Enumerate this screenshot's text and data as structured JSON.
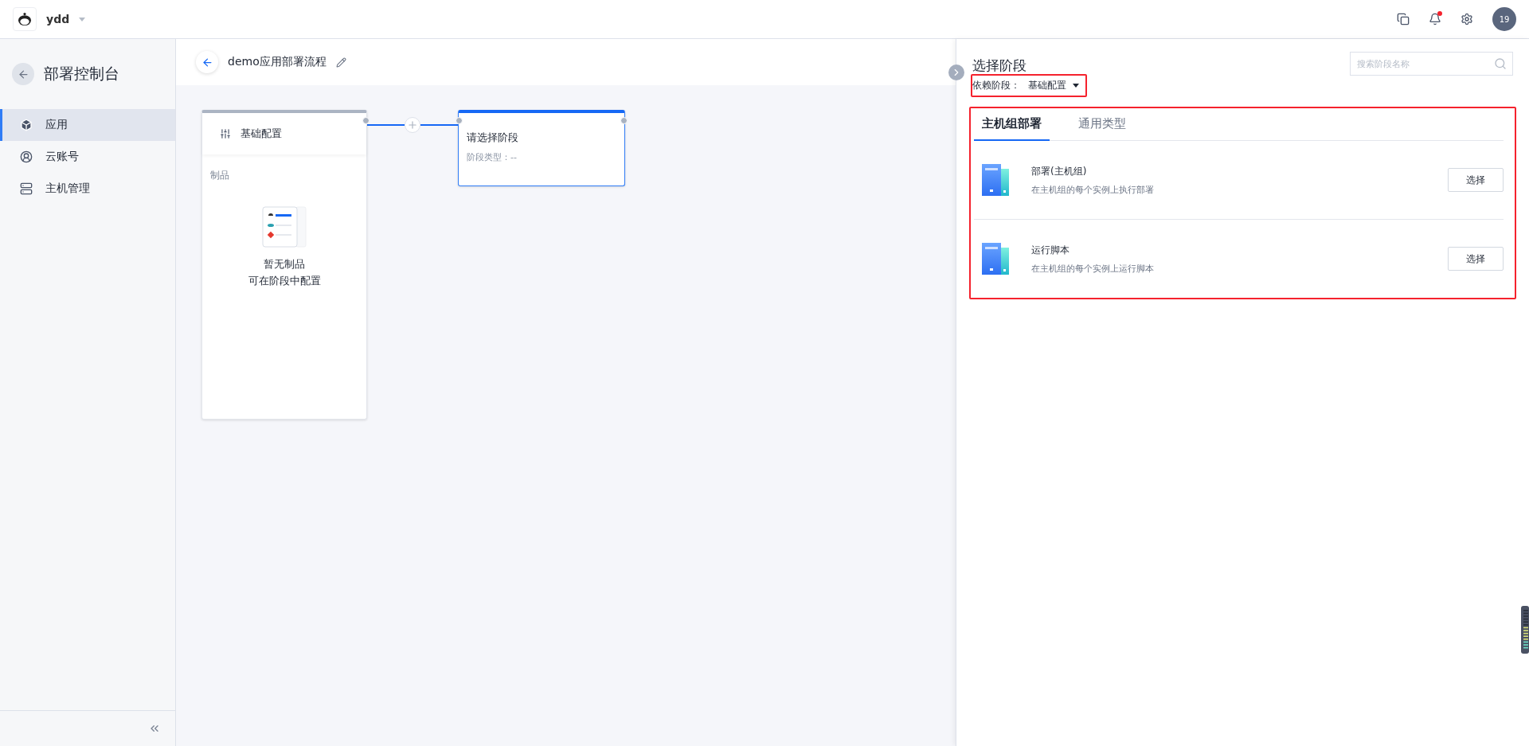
{
  "topbar": {
    "workspace": "ydd",
    "notification_unread": true,
    "avatar": "19"
  },
  "sidebar": {
    "title": "部署控制台",
    "items": [
      {
        "label": "应用",
        "selected": true
      },
      {
        "label": "云账号",
        "selected": false
      },
      {
        "label": "主机管理",
        "selected": false
      }
    ]
  },
  "flow": {
    "title": "demo应用部署流程",
    "nodes": [
      {
        "kind": "config",
        "title": "基础配置",
        "section": "制品",
        "empty_lines": [
          "暂无制品",
          "可在阶段中配置"
        ]
      },
      {
        "kind": "pending",
        "title": "请选择阶段",
        "subtitle": "阶段类型：--"
      }
    ]
  },
  "panel": {
    "title": "选择阶段",
    "search": {
      "placeholder": "搜索阶段名称"
    },
    "dependency": {
      "label": "依赖阶段：",
      "value": "基础配置"
    },
    "tabs": [
      {
        "label": "主机组部署",
        "selected": true
      },
      {
        "label": "通用类型",
        "selected": false
      }
    ],
    "stages": [
      {
        "name": "部署(主机组)",
        "description": "在主机组的每个实例上执行部署",
        "button": "选择"
      },
      {
        "name": "运行脚本",
        "description": "在主机组的每个实例上运行脚本",
        "button": "选择"
      }
    ]
  }
}
